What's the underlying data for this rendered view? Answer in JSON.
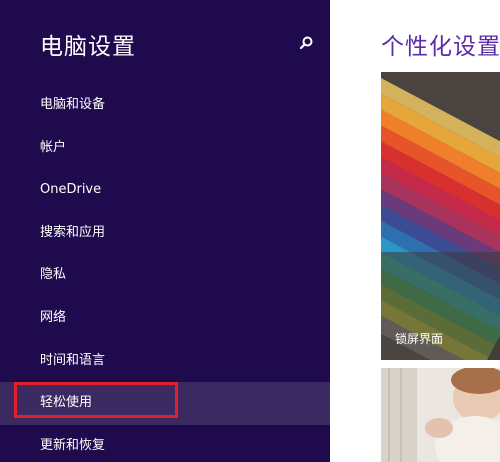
{
  "sidebar": {
    "title": "电脑设置",
    "search_icon": "search-icon",
    "items": [
      {
        "label": "电脑和设备"
      },
      {
        "label": "帐户"
      },
      {
        "label": "OneDrive"
      },
      {
        "label": "搜索和应用"
      },
      {
        "label": "隐私"
      },
      {
        "label": "网络"
      },
      {
        "label": "时间和语言"
      },
      {
        "label": "轻松使用",
        "selected": true
      },
      {
        "label": "更新和恢复"
      }
    ]
  },
  "main": {
    "title": "个性化设置",
    "tiles": [
      {
        "label": "锁屏界面"
      },
      {
        "label": ""
      }
    ]
  },
  "colors": {
    "sidebar_bg": "#1f0a4e",
    "selected_bg": "#3b2a62",
    "title_accent": "#5a2ca8",
    "annotation_red": "#e2202c"
  }
}
